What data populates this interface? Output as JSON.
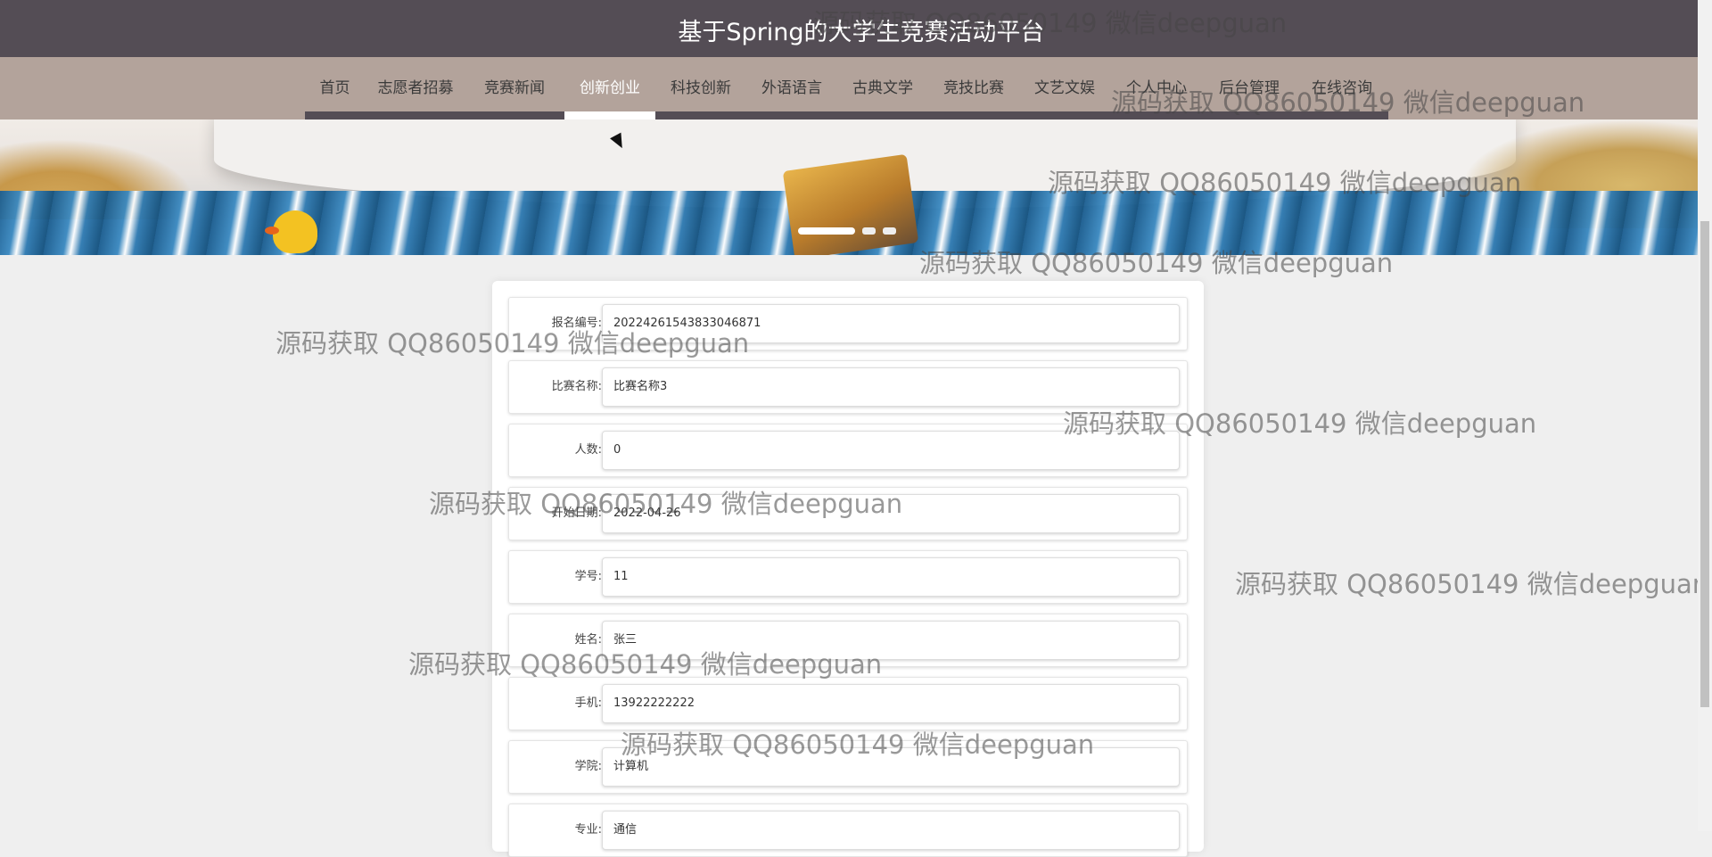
{
  "header": {
    "title": "基于Spring的大学生竞赛活动平台"
  },
  "nav": {
    "items": [
      {
        "label": "首页"
      },
      {
        "label": "志愿者招募"
      },
      {
        "label": "竞赛新闻"
      },
      {
        "label": "创新创业",
        "active": true
      },
      {
        "label": "科技创新"
      },
      {
        "label": "外语语言"
      },
      {
        "label": "古典文学"
      },
      {
        "label": "竞技比赛"
      },
      {
        "label": "文艺文娱"
      },
      {
        "label": "个人中心"
      },
      {
        "label": "后台管理"
      },
      {
        "label": "在线咨询"
      }
    ]
  },
  "banner": {
    "slides": 3,
    "active_slide": 1
  },
  "form": {
    "fields": [
      {
        "label": "报名编号:",
        "value": "20224261543833046871"
      },
      {
        "label": "比赛名称:",
        "value": "比赛名称3"
      },
      {
        "label": "人数:",
        "value": "0"
      },
      {
        "label": "开始日期:",
        "value": "2022-04-26"
      },
      {
        "label": "学号:",
        "value": "11"
      },
      {
        "label": "姓名:",
        "value": "张三"
      },
      {
        "label": "手机:",
        "value": "13922222222"
      },
      {
        "label": "学院:",
        "value": "计算机"
      },
      {
        "label": "专业:",
        "value": "通信"
      }
    ]
  },
  "watermark": {
    "text": "源码获取 QQ86050149 微信deepguan"
  },
  "colors": {
    "header_bg": "#544d55",
    "nav_bg": "#b3a39b",
    "page_bg": "#efefef"
  },
  "icons": {
    "cursor": "mouse-pointer-icon"
  }
}
